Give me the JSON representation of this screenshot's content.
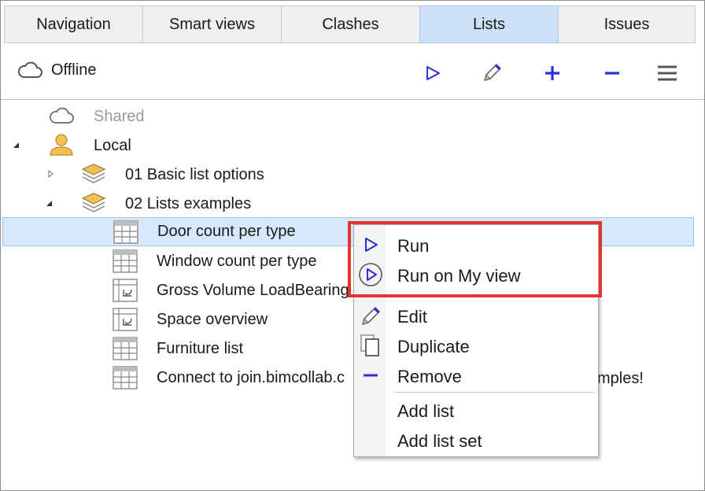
{
  "tabs": [
    {
      "label": "Navigation",
      "active": false
    },
    {
      "label": "Smart views",
      "active": false
    },
    {
      "label": "Clashes",
      "active": false
    },
    {
      "label": "Lists",
      "active": true
    },
    {
      "label": "Issues",
      "active": false
    }
  ],
  "toolbar": {
    "status_label": "Offline",
    "status_icon": "cloud-icon",
    "buttons": [
      {
        "name": "run",
        "icon": "play-icon"
      },
      {
        "name": "edit",
        "icon": "pencil-icon"
      },
      {
        "name": "add",
        "icon": "plus-icon"
      },
      {
        "name": "remove",
        "icon": "minus-icon"
      },
      {
        "name": "menu",
        "icon": "hamburger-icon"
      }
    ]
  },
  "tree": {
    "shared": {
      "label": "Shared",
      "icon": "cloud-icon"
    },
    "local": {
      "label": "Local",
      "icon": "user-icon",
      "expanded": true
    },
    "sets": [
      {
        "label": "01 Basic list options",
        "icon": "layers-icon",
        "expanded": false
      },
      {
        "label": "02 Lists examples",
        "icon": "layers-icon",
        "expanded": true
      }
    ],
    "lists": [
      {
        "label": "Door count per type",
        "icon": "table-icon",
        "selected": true
      },
      {
        "label": "Window count per type",
        "icon": "table-icon",
        "selected": false
      },
      {
        "label": "Gross Volume LoadBearing",
        "icon": "link-table-icon",
        "selected": false
      },
      {
        "label": "Space overview",
        "icon": "link-table-icon",
        "selected": false
      },
      {
        "label": "Furniture list",
        "icon": "table-icon",
        "selected": false
      },
      {
        "label": "Connect to join.bimcollab.c",
        "icon": "table-icon",
        "selected": false
      }
    ],
    "connect_tail": "mples!"
  },
  "context_menu": {
    "items": [
      {
        "label": "Run",
        "icon": "play-icon"
      },
      {
        "label": "Run on My view",
        "icon": "play-circle-icon"
      },
      {
        "label": "Edit",
        "icon": "pencil-icon"
      },
      {
        "label": "Duplicate",
        "icon": "duplicate-icon"
      },
      {
        "label": "Remove",
        "icon": "minus-icon"
      },
      {
        "label": "Add list",
        "icon": ""
      },
      {
        "label": "Add list set",
        "icon": ""
      }
    ]
  },
  "colors": {
    "accent": "#2b2fd6",
    "selection": "#d6e8fb",
    "active_tab": "#cce0f7",
    "highlight_box": "#e3352b",
    "user_icon": "#f2c14e",
    "layers_icon": "#f2c14e"
  }
}
